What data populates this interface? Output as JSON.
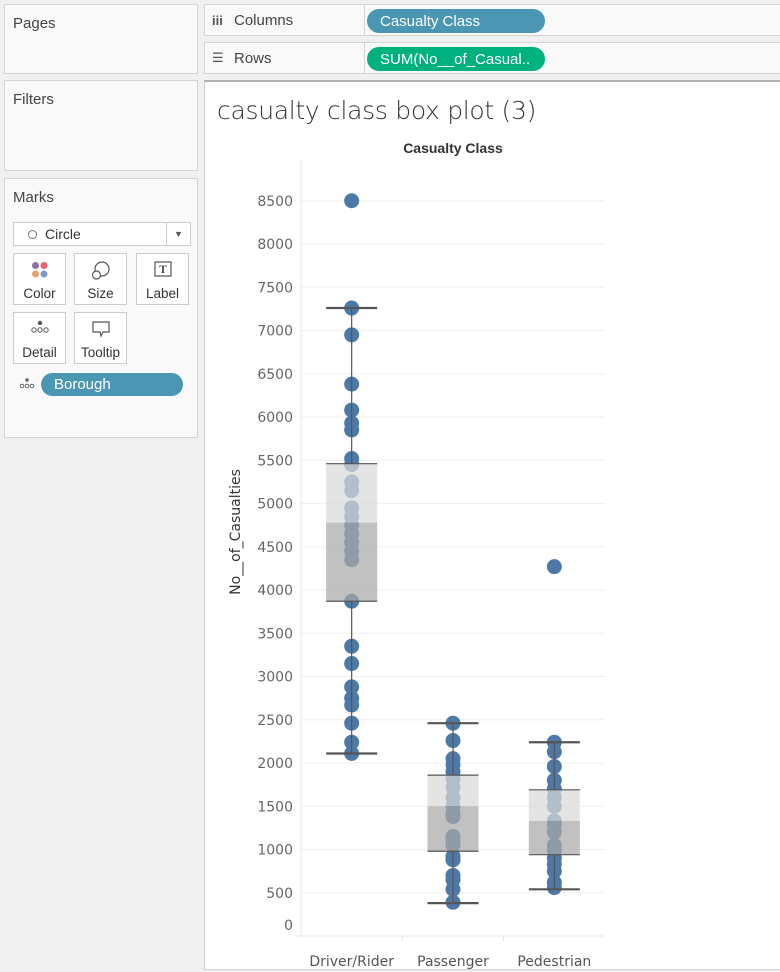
{
  "panes": {
    "pages_label": "Pages",
    "filters_label": "Filters",
    "marks_label": "Marks"
  },
  "shelves": {
    "columns_label": "Columns",
    "columns_icon": "columns-icon",
    "columns_pill": "Casualty Class",
    "rows_label": "Rows",
    "rows_icon": "rows-icon",
    "rows_pill": "SUM(No__of_Casual..",
    "dimension_color": "#4a96b3",
    "measure_color": "#00b180"
  },
  "marks": {
    "type": "Circle",
    "buttons": [
      {
        "label": "Color",
        "icon": "color-icon"
      },
      {
        "label": "Size",
        "icon": "size-icon"
      },
      {
        "label": "Label",
        "icon": "label-icon"
      },
      {
        "label": "Detail",
        "icon": "detail-icon"
      },
      {
        "label": "Tooltip",
        "icon": "tooltip-icon"
      }
    ],
    "detail_field": "Borough"
  },
  "sheet": {
    "title": "casualty class box plot (3)"
  },
  "chart_data": {
    "type": "box",
    "title": "casualty class box plot (3)",
    "column_header": "Casualty Class",
    "xlabel": "",
    "ylabel": "No__of_Casualties",
    "ylim": [
      0,
      8500
    ],
    "yticks": [
      0,
      500,
      1000,
      1500,
      2000,
      2500,
      3000,
      3500,
      4000,
      4500,
      5000,
      5500,
      6000,
      6500,
      7000,
      7500,
      8000,
      8500
    ],
    "grid": true,
    "point_color": "#4e79a7",
    "categories": [
      "Driver/Rider",
      "Passenger",
      "Pedestrian"
    ],
    "series": [
      {
        "name": "Driver/Rider",
        "whisker_low": 2110,
        "q1": 3870,
        "median": 4780,
        "q3": 5460,
        "whisker_high": 7260,
        "points": [
          8500,
          7260,
          6950,
          6380,
          6080,
          5930,
          5850,
          5520,
          5450,
          5250,
          5150,
          4950,
          4850,
          4750,
          4650,
          4550,
          4450,
          4350,
          3870,
          3350,
          3150,
          2880,
          2750,
          2670,
          2460,
          2240,
          2110
        ]
      },
      {
        "name": "Passenger",
        "whisker_low": 380,
        "q1": 980,
        "median": 1500,
        "q3": 1860,
        "whisker_high": 2460,
        "points": [
          2460,
          2260,
          2050,
          1980,
          1900,
          1820,
          1720,
          1600,
          1500,
          1420,
          1380,
          1150,
          1100,
          1050,
          920,
          880,
          700,
          650,
          540,
          390
        ]
      },
      {
        "name": "Pedestrian",
        "whisker_low": 540,
        "q1": 940,
        "median": 1330,
        "q3": 1690,
        "whisker_high": 2240,
        "points": [
          4270,
          2240,
          2130,
          1960,
          1800,
          1700,
          1600,
          1500,
          1330,
          1280,
          1200,
          1050,
          990,
          900,
          830,
          750,
          620,
          560
        ]
      }
    ]
  }
}
